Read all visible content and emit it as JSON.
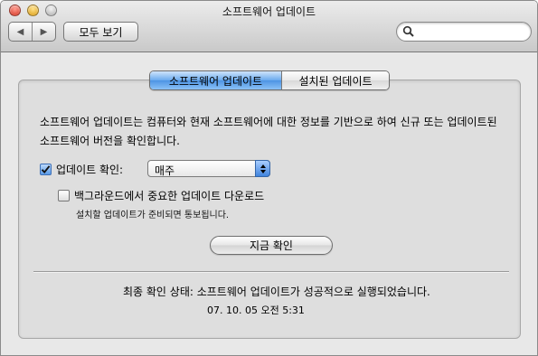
{
  "window": {
    "title": "소프트웨어 업데이트"
  },
  "toolbar": {
    "back_icon": "back-arrow-icon",
    "forward_icon": "forward-arrow-icon",
    "show_all_label": "모두 보기",
    "search": {
      "value": "",
      "placeholder": ""
    }
  },
  "tabs": [
    {
      "label": "소프트웨어 업데이트",
      "selected": true
    },
    {
      "label": "설치된 업데이트",
      "selected": false
    }
  ],
  "main": {
    "description": "소프트웨어 업데이트는 컴퓨터와 현재 소프트웨어에 대한 정보를 기반으로 하여 신규 또는 업데이트된 소프트웨어 버전을 확인합니다.",
    "check_updates": {
      "label": "업데이트 확인:",
      "checked": true
    },
    "frequency": {
      "selected": "매주"
    },
    "background_download": {
      "label": "백그라운드에서 중요한 업데이트 다운로드",
      "checked": false
    },
    "background_note": "설치할 업데이트가 준비되면 통보됩니다.",
    "check_now_label": "지금 확인",
    "status": "최종 확인 상태: 소프트웨어 업데이트가 성공적으로 실행되었습니다.",
    "timestamp": "07. 10. 05 오전 5:31"
  },
  "colors": {
    "accent": "#4d94e4",
    "pane_bg": "#dedede",
    "chrome_top": "#ececec",
    "chrome_bottom": "#c9c9c9"
  }
}
